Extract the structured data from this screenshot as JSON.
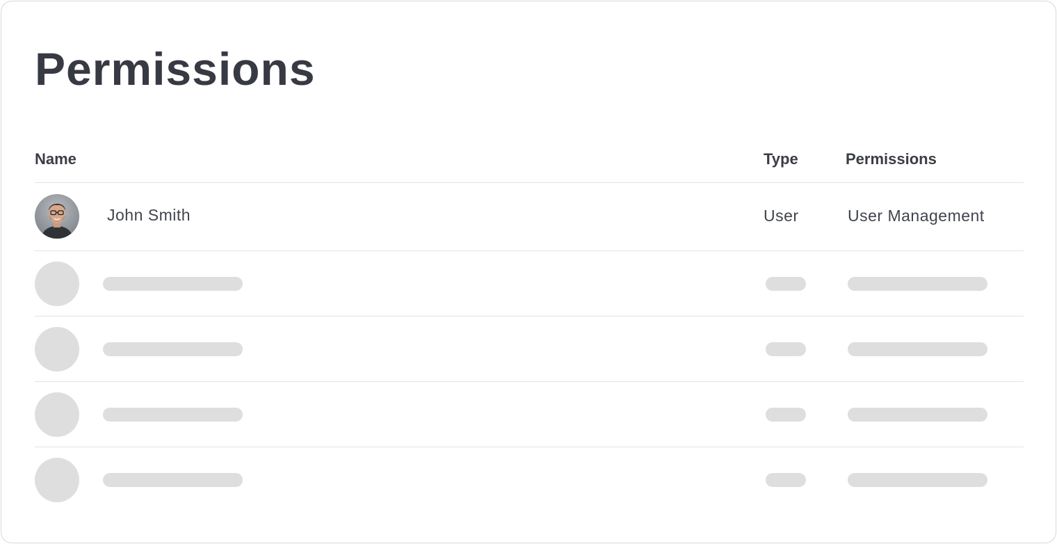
{
  "page": {
    "title": "Permissions"
  },
  "table": {
    "columns": {
      "name": "Name",
      "type": "Type",
      "permissions": "Permissions"
    },
    "rows": [
      {
        "name": "John Smith",
        "type": "User",
        "permissions": "User Management",
        "avatar": "user-photo"
      }
    ],
    "loading_placeholder_rows": 4
  },
  "colors": {
    "text": "#373a43",
    "divider": "#e3e3e3",
    "skeleton": "#dedede",
    "card_border": "#d9d9d9"
  }
}
